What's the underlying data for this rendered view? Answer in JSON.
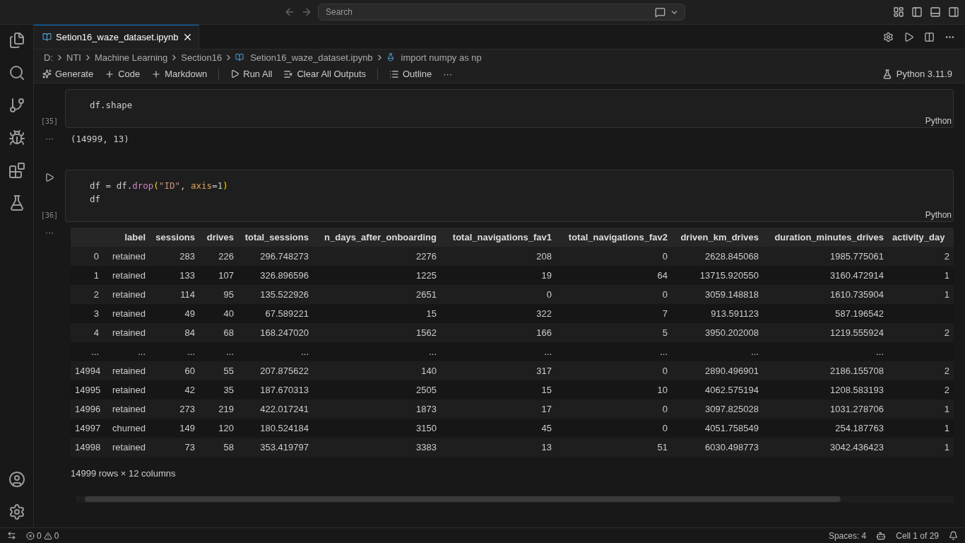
{
  "title_bar": {
    "search": {
      "placeholder": "Search"
    }
  },
  "tab": {
    "title": "Setion16_waze_dataset.ipynb",
    "selected": true
  },
  "breadcrumb": [
    "D:",
    "NTI",
    "Machine Learning",
    "Section16",
    "Setion16_waze_dataset.ipynb",
    "import numpy as np"
  ],
  "toolbar": {
    "items": [
      {
        "kind": "generate",
        "label": "Generate"
      },
      {
        "kind": "add",
        "label": "Code"
      },
      {
        "kind": "add",
        "label": "Markdown"
      },
      {
        "kind": "run",
        "label": "Run All"
      },
      {
        "kind": "clear",
        "label": "Clear All Outputs"
      },
      {
        "kind": "outline",
        "label": "Outline"
      },
      {
        "kind": "more",
        "label": "···"
      }
    ],
    "kernel": "Python 3.11.9"
  },
  "cells": [
    {
      "count": "[35]",
      "language": "Python",
      "lines": [
        [
          {
            "t": "df.shape",
            "kind": "plain"
          }
        ]
      ],
      "output": {
        "kind": "text",
        "more": "···",
        "text": "(14999, 13)"
      }
    },
    {
      "count": "[36]",
      "language": "Python",
      "run_button": true,
      "lines": [
        [
          {
            "t": "df = df.",
            "kind": "plain"
          },
          {
            "t": "drop",
            "kind": "func"
          },
          {
            "t": "(",
            "kind": "paren"
          },
          {
            "t": "\"ID\"",
            "kind": "string"
          },
          {
            "t": ", ",
            "kind": "plain"
          },
          {
            "t": "axis",
            "kind": "param"
          },
          {
            "t": "=",
            "kind": "plain"
          },
          {
            "t": "1",
            "kind": "number"
          },
          {
            "t": ")",
            "kind": "paren"
          }
        ],
        [
          {
            "t": "df",
            "kind": "plain"
          }
        ]
      ],
      "output": {
        "kind": "table",
        "more": "···",
        "columns": [
          "",
          "label",
          "sessions",
          "drives",
          "total_sessions",
          "n_days_after_onboarding",
          "total_navigations_fav1",
          "total_navigations_fav2",
          "driven_km_drives",
          "duration_minutes_drives",
          "activity_day"
        ],
        "rows": [
          [
            "0",
            "retained",
            "283",
            "226",
            "296.748273",
            "2276",
            "208",
            "0",
            "2628.845068",
            "1985.775061",
            "2"
          ],
          [
            "1",
            "retained",
            "133",
            "107",
            "326.896596",
            "1225",
            "19",
            "64",
            "13715.920550",
            "3160.472914",
            "1"
          ],
          [
            "2",
            "retained",
            "114",
            "95",
            "135.522926",
            "2651",
            "0",
            "0",
            "3059.148818",
            "1610.735904",
            "1"
          ],
          [
            "3",
            "retained",
            "49",
            "40",
            "67.589221",
            "15",
            "322",
            "7",
            "913.591123",
            "587.196542"
          ],
          [
            "4",
            "retained",
            "84",
            "68",
            "168.247020",
            "1562",
            "166",
            "5",
            "3950.202008",
            "1219.555924",
            "2"
          ],
          [
            "...",
            "...",
            "...",
            "...",
            "...",
            "...",
            "...",
            "...",
            "...",
            "..."
          ],
          [
            "14994",
            "retained",
            "60",
            "55",
            "207.875622",
            "140",
            "317",
            "0",
            "2890.496901",
            "2186.155708",
            "2"
          ],
          [
            "14995",
            "retained",
            "42",
            "35",
            "187.670313",
            "2505",
            "15",
            "10",
            "4062.575194",
            "1208.583193",
            "2"
          ],
          [
            "14996",
            "retained",
            "273",
            "219",
            "422.017241",
            "1873",
            "17",
            "0",
            "3097.825028",
            "1031.278706",
            "1"
          ],
          [
            "14997",
            "churned",
            "149",
            "120",
            "180.524184",
            "3150",
            "45",
            "0",
            "4051.758549",
            "254.187763",
            "1"
          ],
          [
            "14998",
            "retained",
            "73",
            "58",
            "353.419797",
            "3383",
            "13",
            "51",
            "6030.498773",
            "3042.436423",
            "1"
          ]
        ],
        "summary": "14999 rows × 12 columns"
      }
    }
  ],
  "status_bar": {
    "problems": {
      "errors": "0",
      "warnings": "0"
    },
    "spaces": "Spaces: 4",
    "cell": "Cell 1 of 29"
  }
}
